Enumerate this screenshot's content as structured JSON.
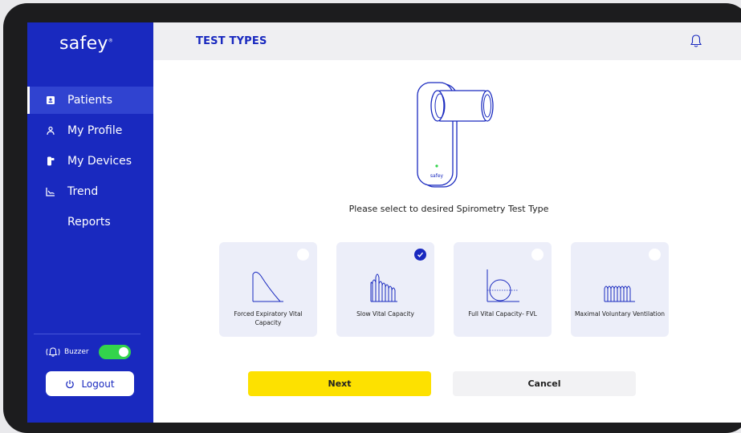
{
  "app": {
    "logo": "safey",
    "logo_mark": "®"
  },
  "sidebar": {
    "items": [
      {
        "label": "Patients",
        "icon": "patients-icon",
        "active": true
      },
      {
        "label": "My Profile",
        "icon": "profile-icon",
        "active": false
      },
      {
        "label": "My Devices",
        "icon": "devices-icon",
        "active": false
      },
      {
        "label": "Trend",
        "icon": "trend-icon",
        "active": false
      },
      {
        "label": "Reports",
        "icon": "",
        "active": false
      }
    ],
    "buzzer_label": "Buzzer",
    "buzzer_on": true,
    "logout_label": "Logout"
  },
  "header": {
    "title": "TEST TYPES"
  },
  "device": {
    "brand_label": "safey"
  },
  "main": {
    "prompt": "Please select to desired Spirometry Test Type",
    "cards": [
      {
        "label": "Forced Expiratory Vital Capacity",
        "selected": false
      },
      {
        "label": "Slow Vital Capacity",
        "selected": true
      },
      {
        "label": "Full Vital Capacity- FVL",
        "selected": false
      },
      {
        "label": "Maximal Voluntary Ventilation",
        "selected": false
      }
    ],
    "next_label": "Next",
    "cancel_label": "Cancel"
  },
  "colors": {
    "primary": "#1929bf",
    "accent_yellow": "#fde100",
    "toggle_green": "#33d44c",
    "card_bg": "#eceef9"
  }
}
